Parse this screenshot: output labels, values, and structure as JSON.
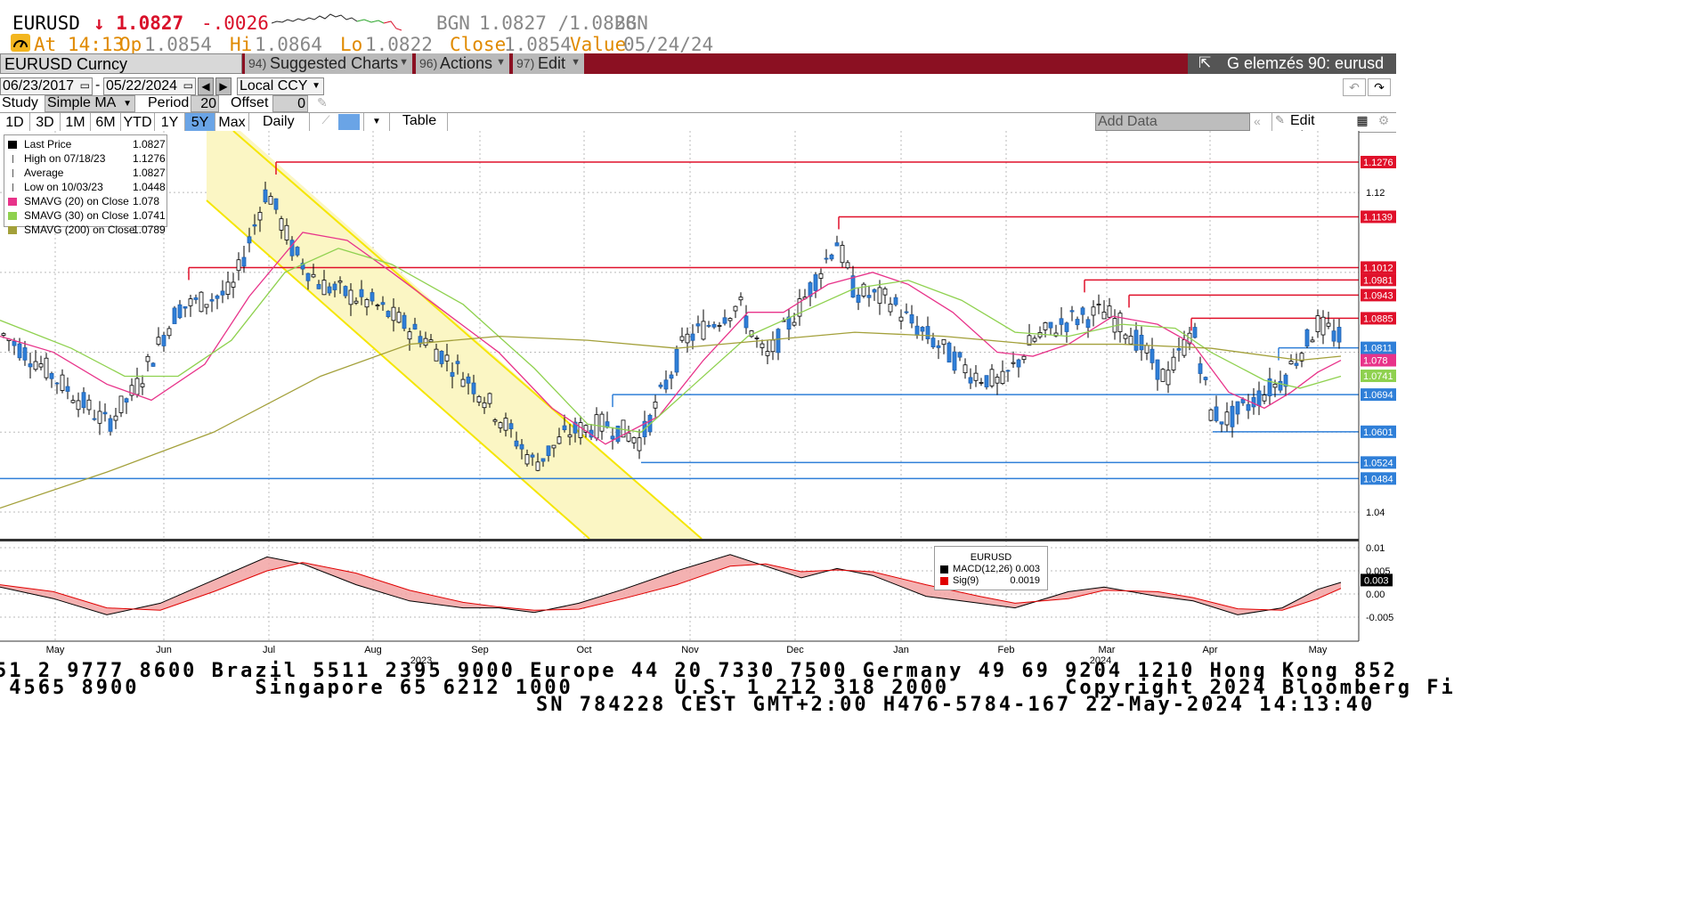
{
  "header": {
    "symbol": "EURUSD",
    "last": "↓ 1.0827",
    "change": "-.0026",
    "source": "BGN",
    "bid_ask": "1.0827 /1.0828",
    "source2": "BGN",
    "at": "At 14:13",
    "op_label": "Op",
    "op": "1.0854",
    "hi_label": "Hi",
    "hi": "1.0864",
    "lo_label": "Lo",
    "lo": "1.0822",
    "close_label": "Close",
    "close": "1.0854",
    "value_label": "Value",
    "value": "05/24/24"
  },
  "command_bar": {
    "security": "EURUSD Curncy",
    "suggested_num": "94)",
    "suggested": "Suggested Charts",
    "actions_num": "96)",
    "actions": "Actions",
    "edit_num": "97)",
    "edit": "Edit",
    "function_title": "G elemzés 90: eurusd"
  },
  "toolbar": {
    "start_date": "06/23/2017",
    "end_date": "05/22/2024",
    "currency": "Local CCY",
    "study_label": "Study",
    "study": "Simple MA",
    "period_label": "Period",
    "period": "20",
    "offset_label": "Offset",
    "offset": "0",
    "ranges": [
      "1D",
      "3D",
      "1M",
      "6M",
      "YTD",
      "1Y",
      "5Y",
      "Max"
    ],
    "active_range": "5Y",
    "frequency": "Daily ▼",
    "table": "Table",
    "add_data_placeholder": "Add Data",
    "edit_chart": "Edit Chart"
  },
  "legend": [
    {
      "label": "Last Price",
      "value": "1.0827",
      "color": "#000000"
    },
    {
      "label": "High on 07/18/23",
      "value": "1.1276",
      "color": "#555555"
    },
    {
      "label": "Average",
      "value": "1.0827",
      "color": "#555555"
    },
    {
      "label": "Low on 10/03/23",
      "value": "1.0448",
      "color": "#555555"
    },
    {
      "label": "SMAVG (20)  on Close",
      "value": "1.078",
      "color": "#e8338a"
    },
    {
      "label": "SMAVG (30)  on Close",
      "value": "1.0741",
      "color": "#8fd14f"
    },
    {
      "label": "SMAVG (200)  on Close",
      "value": "1.0789",
      "color": "#a3a03a"
    }
  ],
  "macd_legend": {
    "title": "EURUSD",
    "items": [
      {
        "label": "MACD(12,26)",
        "value": "0.003",
        "color": "#000000"
      },
      {
        "label": "Sig(9)",
        "value": "0.0019",
        "color": "#e00000"
      }
    ]
  },
  "price_axis": {
    "ticks": [
      "1.12",
      "1.04"
    ],
    "labels": [
      {
        "text": "1.1276",
        "bg": "#e0102a"
      },
      {
        "text": "1.1139",
        "bg": "#e0102a"
      },
      {
        "text": "1.1012",
        "bg": "#e0102a"
      },
      {
        "text": "1.0981",
        "bg": "#e0102a"
      },
      {
        "text": "1.0943",
        "bg": "#e0102a"
      },
      {
        "text": "1.0885",
        "bg": "#e0102a"
      },
      {
        "text": "1.0811",
        "bg": "#2f7fd8"
      },
      {
        "text": "1.078",
        "bg": "#e8338a"
      },
      {
        "text": "1.0741",
        "bg": "#8fd14f"
      },
      {
        "text": "1.0694",
        "bg": "#2f7fd8"
      },
      {
        "text": "1.0601",
        "bg": "#2f7fd8"
      },
      {
        "text": "1.0524",
        "bg": "#2f7fd8"
      },
      {
        "text": "1.0484",
        "bg": "#2f7fd8"
      }
    ]
  },
  "macd_axis": {
    "ticks": [
      "0.01",
      "0.005",
      "0.003",
      "0.00",
      "-0.005"
    ]
  },
  "time_axis": {
    "months": [
      "May",
      "Jun",
      "Jul",
      "Aug",
      "Sep",
      "Oct",
      "Nov",
      "Dec",
      "Jan",
      "Feb",
      "Mar",
      "Apr",
      "May"
    ],
    "years": [
      "2023",
      "2024"
    ]
  },
  "ticker": {
    "line1": "51 2 9777 8600 Brazil 5511 2395 9000 Europe 44 20 7330 7500 Germany 49 69 9204 1210 Hong Kong 852",
    "line2": " 4565 8900        Singapore 65 6212 1000       U.S. 1 212 318 2000        Copyright 2024 Bloomberg Fi",
    "line3": "SN 784228 CEST GMT+2:00 H476-5784-167 22-May-2024 14:13:40"
  },
  "colors": {
    "up": "#ffffff",
    "down": "#2f7fd8",
    "brand_bar": "#8b1022",
    "resistance": "#e0102a",
    "support": "#2f7fd8",
    "channel": "#f5e600"
  }
}
